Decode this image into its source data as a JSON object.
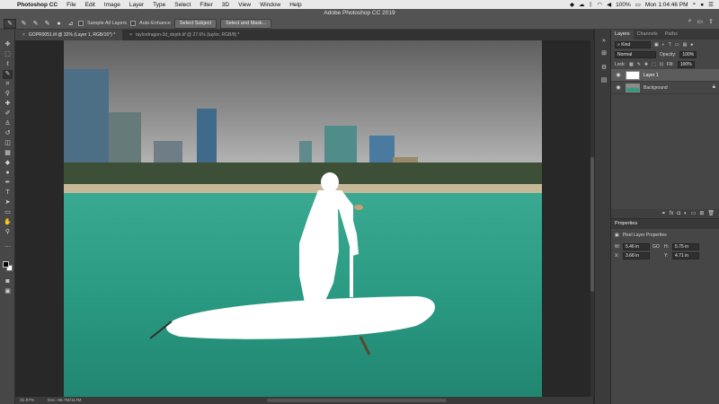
{
  "menubar": {
    "apple": "",
    "app_name": "Photoshop CC",
    "items": [
      "File",
      "Edit",
      "Image",
      "Layer",
      "Type",
      "Select",
      "Filter",
      "3D",
      "View",
      "Window",
      "Help"
    ],
    "battery": "100%",
    "time": "Mon 1:04:46 PM"
  },
  "window": {
    "title": "Adobe Photoshop CC 2019"
  },
  "options": {
    "sample_all_layers": "Sample All Layers",
    "auto_enhance": "Auto-Enhance",
    "select_subject": "Select Subject",
    "select_and_mask": "Select and Mask..."
  },
  "tabs": [
    {
      "label": "GOPR0051.tif @ 32% (Layer 1, RGB/16*) *"
    },
    {
      "label": "taylordragon-3d_depth.tif @ 27.6% (taylor, RGB/8) *"
    }
  ],
  "status": {
    "zoom": "31.87%",
    "doc": "Doc: 66.7M/117M"
  },
  "layers_panel": {
    "tabs": [
      "Layers",
      "Channels",
      "Paths"
    ],
    "filter_kind": "Kind",
    "blend_mode": "Normal",
    "opacity_label": "Opacity:",
    "opacity_value": "100%",
    "lock_label": "Lock:",
    "fill_label": "Fill:",
    "fill_value": "100%",
    "layers": [
      {
        "name": "Layer 1",
        "selected": true
      },
      {
        "name": "Background",
        "selected": false
      }
    ]
  },
  "properties": {
    "title": "Properties",
    "subtitle": "Pixel Layer Properties",
    "w_label": "W:",
    "w_value": "5.46 in",
    "go_label": "GO",
    "h_label": "H:",
    "h_value": "5.75 in",
    "x_label": "X:",
    "x_value": "3.68 in",
    "y_label": "Y:",
    "y_value": "4.71 in"
  },
  "icons": {
    "toolbar": [
      "move-icon",
      "marquee-icon",
      "lasso-icon",
      "quick-select-icon",
      "crop-icon",
      "eyedropper-icon",
      "healing-icon",
      "brush-icon",
      "stamp-icon",
      "history-brush-icon",
      "eraser-icon",
      "gradient-icon",
      "blur-icon",
      "dodge-icon",
      "pen-icon",
      "type-icon",
      "path-select-icon",
      "shape-icon",
      "hand-icon",
      "zoom-icon"
    ]
  },
  "colors": {
    "water": "#2e9d86",
    "sky": "#8a8a8a",
    "ui_dark": "#464646"
  }
}
